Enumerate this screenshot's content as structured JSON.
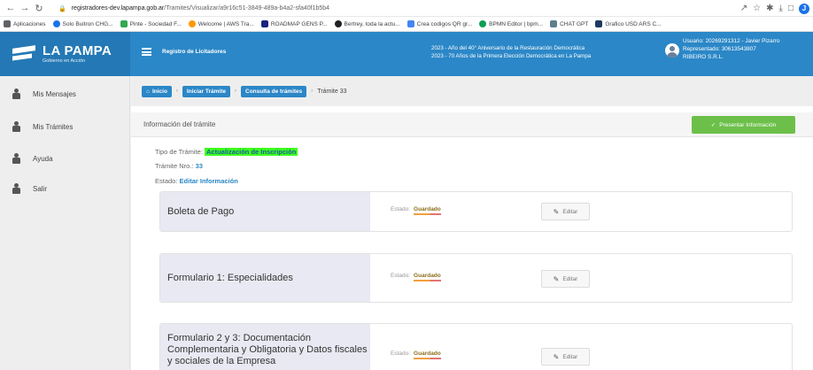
{
  "browser": {
    "url_host": "registradores-dev.lapampa.gob.ar",
    "url_path": "/Tramites/Visualizar/a9r16c51-3849-489a-b4a2-sfa40f1b5b4",
    "bookmarks": [
      {
        "label": "Aplicaciones",
        "color": "#5f6368"
      },
      {
        "label": "Solo Buitron CHG...",
        "color": "#1a73e8"
      },
      {
        "label": "Pinte - Sociedad F...",
        "color": "#34a853"
      },
      {
        "label": "Welcome | AWS Tra...",
        "color": "#ff9900"
      },
      {
        "label": "ROADMAP GENS P...",
        "color": "#1a237e"
      },
      {
        "label": "Bertrey, toda la actu...",
        "color": "#202124"
      },
      {
        "label": "Crea codigos QR gr...",
        "color": "#4285f4"
      },
      {
        "label": "BPMN Editor | bpm...",
        "color": "#0f9d58"
      },
      {
        "label": "CHAT GPT",
        "color": "#607d8b"
      },
      {
        "label": "Grafico USD ARS C...",
        "color": "#1e3a5f"
      }
    ]
  },
  "header": {
    "logo_title": "LA PAMPA",
    "logo_subtitle": "Gobierno en Acción",
    "app_name": "Registro de Licitadores",
    "anniversary_line1": "2023 - Año del 40° Aniversario de la Restauración Democrática",
    "anniversary_line2": "2023 - 70 Años de la Primera Elección Democrática en La Pampa",
    "user_line1": "Usuario: 20269291312 - Javier Pizarro",
    "user_line2": "Representado: 30613543807",
    "user_line3": "RIBEIRO S.R.L."
  },
  "sidebar": {
    "items": [
      {
        "label": "Mis Mensajes"
      },
      {
        "label": "Mis Trámites"
      },
      {
        "label": "Ayuda"
      },
      {
        "label": "Salir"
      }
    ]
  },
  "breadcrumb": {
    "home": "Inicio",
    "iniciar": "Iniciar Trámite",
    "consulta": "Consulta de trámites",
    "current": "Trámite 33"
  },
  "info": {
    "title": "Información del trámite",
    "present_button": "Presentar Información",
    "tipo_label": "Tipo de Trámite:",
    "tipo_value": "Actualización de Inscripción",
    "nro_label": "Trámite Nro.:",
    "nro_value": "33",
    "estado_label": "Estado:",
    "estado_value": "Editar Información"
  },
  "cards": [
    {
      "title": "Boleta de Pago",
      "status_label": "Estado:",
      "status_value": "Guardado",
      "edit_label": "Editar"
    },
    {
      "title": "Formulario 1: Especialidades",
      "status_label": "Estado:",
      "status_value": "Guardado",
      "edit_label": "Editar"
    },
    {
      "title": "Formulario 2 y 3: Documentación Complementaria y Obligatoria y Datos fiscales y sociales de la Empresa",
      "status_label": "Estado:",
      "status_value": "Guardado",
      "edit_label": "Editar"
    }
  ],
  "colors": {
    "header_blue": "#2b87c7",
    "present_green": "#6cc04a",
    "highlight_green": "#3cff1c"
  }
}
